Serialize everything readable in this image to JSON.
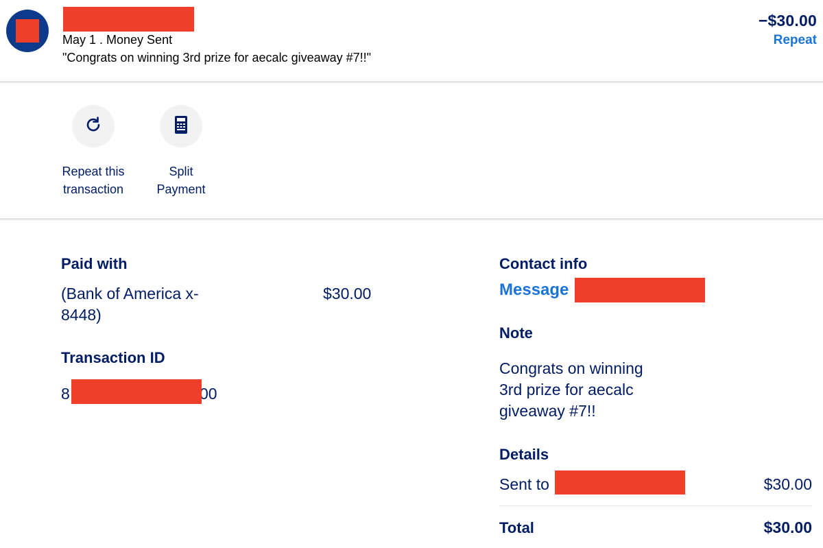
{
  "header": {
    "date_type": "May 1 . Money Sent",
    "memo": "\"Congrats on winning 3rd prize for aecalc giveaway #7!!\"",
    "amount": "−$30.00",
    "repeat_link": "Repeat"
  },
  "actions": [
    {
      "label_line1": "Repeat this",
      "label_line2": "transaction",
      "icon": "refresh-icon"
    },
    {
      "label_line1": "Split",
      "label_line2": "Payment",
      "icon": "calculator-icon"
    }
  ],
  "paid_with": {
    "heading": "Paid with",
    "source_line1": "(Bank of America x-",
    "source_line2": "8448)",
    "amount": "$30.00"
  },
  "transaction_id": {
    "heading": "Transaction ID",
    "prefix": "8",
    "suffix": "00"
  },
  "contact": {
    "heading": "Contact info",
    "message_link": "Message"
  },
  "note": {
    "heading": "Note",
    "line1": "Congrats on winning",
    "line2": "3rd prize for aecalc",
    "line3": "giveaway #7!!"
  },
  "details": {
    "heading": "Details",
    "sent_to_label": "Sent to",
    "sent_to_amount": "$30.00",
    "total_label": "Total",
    "total_amount": "$30.00"
  },
  "colors": {
    "navy": "#001c64",
    "link_blue": "#1a73d6",
    "redaction_red": "#ef3e2a",
    "avatar_blue": "#0e3a8c"
  }
}
